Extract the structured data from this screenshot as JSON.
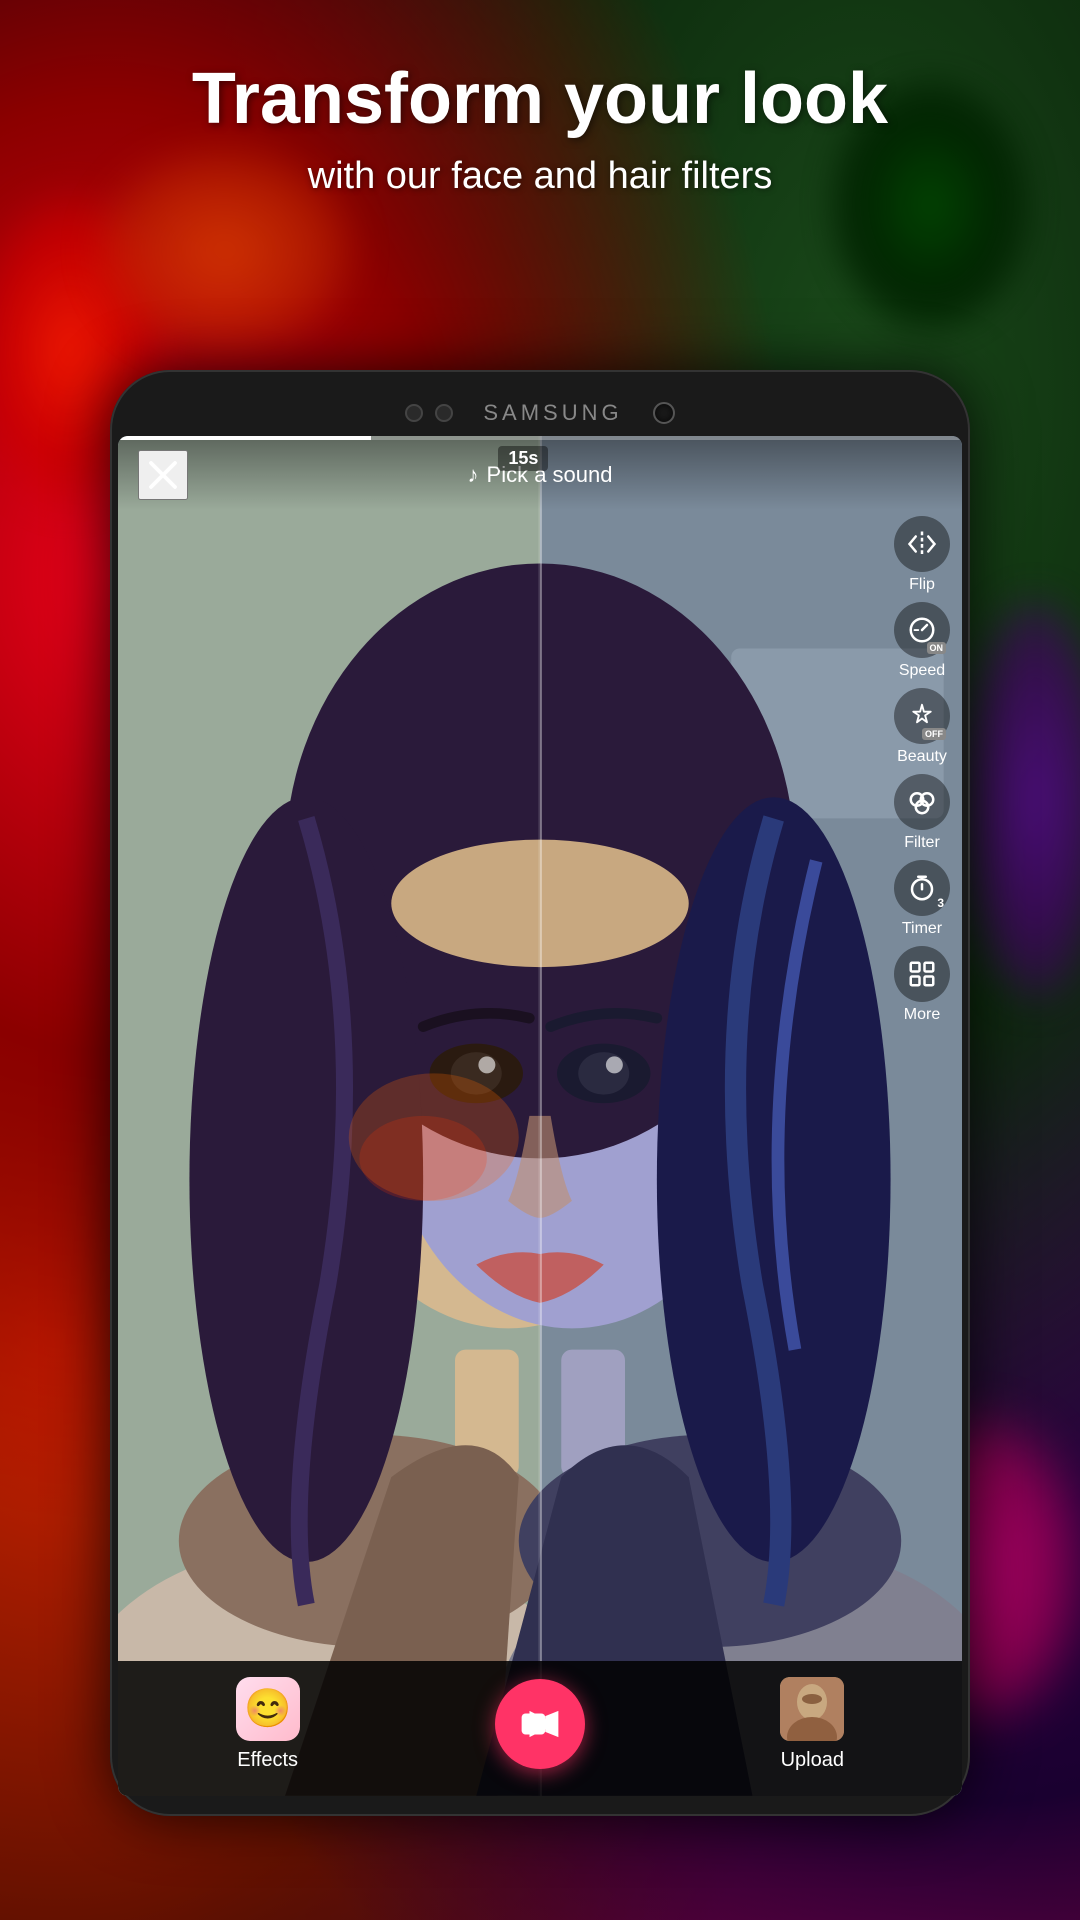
{
  "app": {
    "title": "Transform your look",
    "subtitle": "with our face and hair filters"
  },
  "phone": {
    "brand": "SAMSUNG",
    "timer": "15s",
    "top_nav": {
      "close_label": "×",
      "pick_sound": "Pick a sound"
    },
    "controls": [
      {
        "id": "flip",
        "label": "Flip",
        "icon": "flip"
      },
      {
        "id": "speed",
        "label": "Speed",
        "icon": "speed",
        "badge": "ON"
      },
      {
        "id": "beauty",
        "label": "Beauty",
        "icon": "beauty",
        "badge": "OFF"
      },
      {
        "id": "filter",
        "label": "Filter",
        "icon": "filter"
      },
      {
        "id": "timer",
        "label": "Timer",
        "icon": "timer",
        "badge": "3"
      },
      {
        "id": "more",
        "label": "More",
        "icon": "more"
      }
    ],
    "bottom_bar": {
      "effects_label": "Effects",
      "upload_label": "Upload",
      "record_icon": "video-camera"
    }
  },
  "colors": {
    "accent": "#ff3366",
    "background_dark": "#0a0a1a",
    "phone_dark": "#1a1a1a"
  }
}
